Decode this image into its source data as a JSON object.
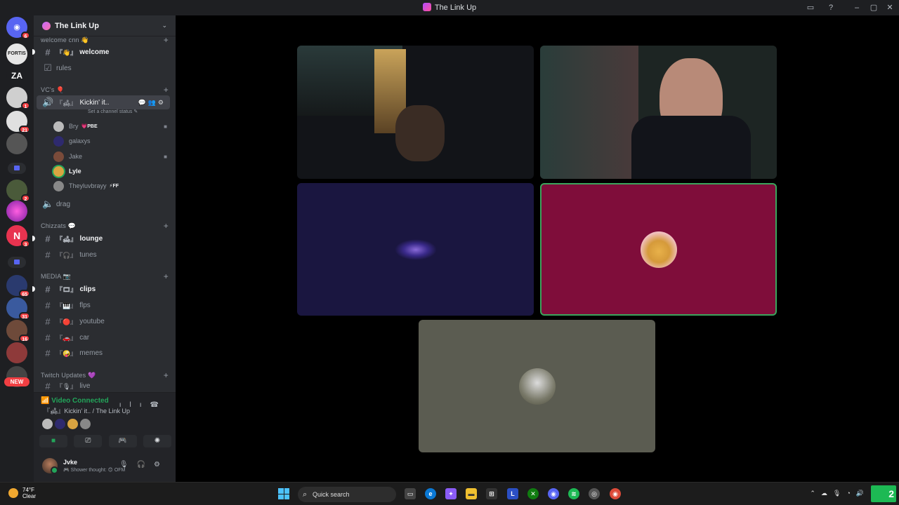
{
  "window": {
    "title": "The Link Up"
  },
  "rail": {
    "servers": [
      {
        "label": "",
        "badge": "6"
      },
      {
        "label": "FORTIS",
        "badge": ""
      },
      {
        "label": "ZA",
        "badge": ""
      },
      {
        "label": "",
        "badge": "1"
      },
      {
        "label": "",
        "badge": "21"
      },
      {
        "label": "",
        "badge": ""
      },
      {
        "label": "",
        "badge": "2"
      },
      {
        "label": "",
        "badge": ""
      },
      {
        "label": "N",
        "badge": "3"
      },
      {
        "label": "",
        "badge": "65"
      },
      {
        "label": "",
        "badge": "31"
      },
      {
        "label": "",
        "badge": "16"
      },
      {
        "label": "",
        "badge": ""
      }
    ],
    "new_label": "NEW"
  },
  "server": {
    "name": "The Link Up"
  },
  "categories": {
    "welcome": "welcome cnn 👋",
    "vcs": "VC's 🎈",
    "chizzats": "Chizzats 💬",
    "media": "MEDIA 📷",
    "twitch": "Twitch Updates 💜"
  },
  "channels": {
    "welcome": {
      "emoji": "『👋』",
      "name": "welcome"
    },
    "rules": {
      "name": "rules"
    },
    "kickin": {
      "emoji": "『🛋』",
      "name": "Kickin' it.."
    },
    "set_status": "Set a channel status ✎",
    "drag": {
      "name": "drag"
    },
    "lounge": {
      "emoji": "『🛋』",
      "name": "lounge"
    },
    "tunes": {
      "emoji": "『🎧』",
      "name": "tunes"
    },
    "clips": {
      "emoji": "『🎞』",
      "name": "clips"
    },
    "flps": {
      "emoji": "『🎹』",
      "name": "flps"
    },
    "youtube": {
      "emoji": "『🔴』",
      "name": "youtube"
    },
    "car": {
      "emoji": "『🚗』",
      "name": "car"
    },
    "memes": {
      "emoji": "『🤪』",
      "name": "memes"
    },
    "live": {
      "emoji": "『🎙』",
      "name": "live"
    }
  },
  "members": [
    {
      "name": "Bry",
      "tag": "💗PBE",
      "bold": false,
      "camera": true,
      "color": "#bbbbbb"
    },
    {
      "name": "galaxys",
      "tag": "",
      "bold": false,
      "camera": false,
      "color": "#2e2a6e"
    },
    {
      "name": "Jake",
      "tag": "",
      "bold": false,
      "camera": true,
      "color": "#7a4b3a"
    },
    {
      "name": "Lyle",
      "tag": "",
      "bold": true,
      "camera": false,
      "color": "#d9a441"
    },
    {
      "name": "Theyluvbrayy",
      "tag": "⚡FF",
      "bold": false,
      "camera": false,
      "color": "#888888"
    }
  ],
  "voice": {
    "status": "Video Connected",
    "channel": "『🛋』Kickin' it.. / The Link Up"
  },
  "user": {
    "name": "Jvke",
    "status": "🎮 Shower thought: 😊 OFM"
  },
  "taskbar": {
    "temp": "74°F",
    "condition": "Clear",
    "search_placeholder": "Quick search",
    "clock_day": "2"
  },
  "colors": {
    "accent_green": "#23a55a",
    "speaking_border": "#3ba55c",
    "tile_speaking": "#7f0d3a"
  }
}
